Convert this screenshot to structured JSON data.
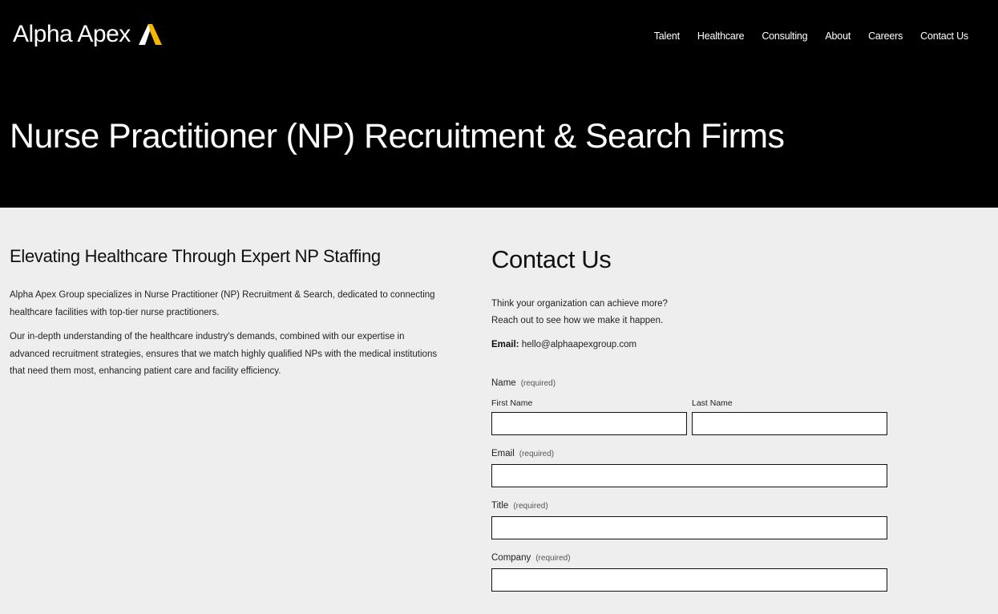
{
  "brand": {
    "name": "Alpha Apex",
    "accent": "#f5b600"
  },
  "nav": {
    "items": [
      "Talent",
      "Healthcare",
      "Consulting",
      "About",
      "Careers",
      "Contact Us"
    ]
  },
  "hero": {
    "title": "Nurse Practitioner (NP) Recruitment & Search Firms"
  },
  "intro_section": {
    "heading": "Elevating Healthcare Through Expert NP Staffing",
    "paragraph1": "Alpha Apex Group specializes in Nurse Practitioner (NP) Recruitment & Search, dedicated to connecting healthcare facilities with top-tier nurse practitioners.",
    "paragraph2": "Our in-depth understanding of the healthcare industry's demands, combined with our expertise in advanced recruitment strategies, ensures that we match highly qualified NPs with the medical institutions that need them most, enhancing patient care and facility efficiency."
  },
  "contact": {
    "heading": "Contact Us",
    "line1": "Think your organization can achieve more?",
    "line2": "Reach out to see how we make it happen.",
    "email_label": "Email:",
    "email_value": "hello@alphaapexgroup.com"
  },
  "form": {
    "required_text": "(required)",
    "name_label": "Name",
    "first_name_label": "First Name",
    "first_name_value": "",
    "last_name_label": "Last Name",
    "last_name_value": "",
    "email_label": "Email",
    "email_value": "",
    "title_label": "Title",
    "title_value": "",
    "company_label": "Company",
    "company_value": ""
  }
}
